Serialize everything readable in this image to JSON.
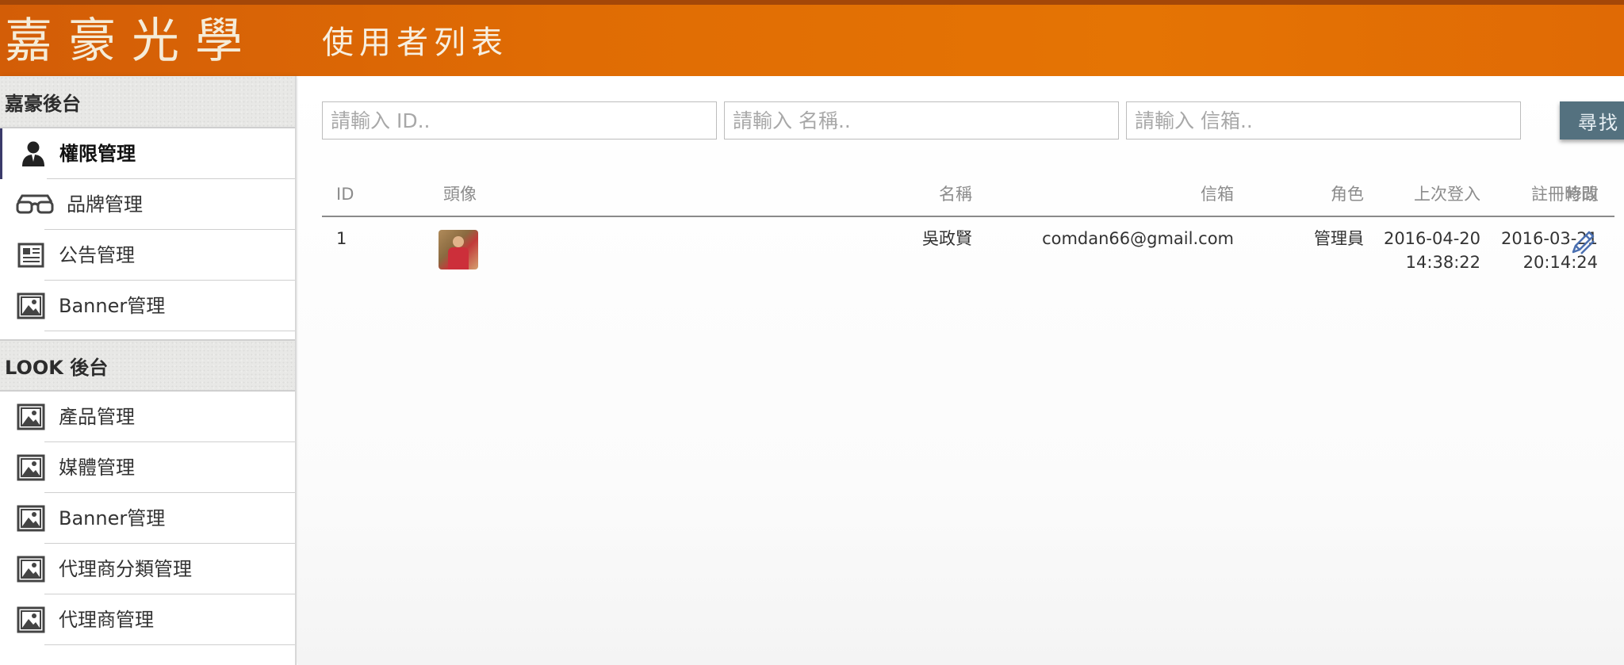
{
  "header": {
    "brand": "嘉豪光學",
    "page_title": "使用者列表"
  },
  "sidebar": {
    "sections": [
      {
        "title": "嘉豪後台",
        "items": [
          {
            "label": "權限管理",
            "icon": "user-icon"
          },
          {
            "label": "品牌管理",
            "icon": "glasses-icon"
          },
          {
            "label": "公告管理",
            "icon": "document-icon"
          },
          {
            "label": "Banner管理",
            "icon": "image-icon"
          }
        ]
      },
      {
        "title": "LOOK 後台",
        "items": [
          {
            "label": "產品管理",
            "icon": "image-icon"
          },
          {
            "label": "媒體管理",
            "icon": "image-icon"
          },
          {
            "label": "Banner管理",
            "icon": "image-icon"
          },
          {
            "label": "代理商分類管理",
            "icon": "image-icon"
          },
          {
            "label": "代理商管理",
            "icon": "image-icon"
          }
        ]
      }
    ]
  },
  "search": {
    "id_placeholder": "請輸入 ID..",
    "name_placeholder": "請輸入 名稱..",
    "email_placeholder": "請輸入 信箱..",
    "button_label": "尋找"
  },
  "table": {
    "headers": {
      "id": "ID",
      "avatar": "頭像",
      "name": "名稱",
      "email": "信箱",
      "role": "角色",
      "last_login": "上次登入",
      "registered": "註冊時間",
      "edit": "修改"
    },
    "rows": [
      {
        "id": "1",
        "name": "吳政賢",
        "email": "comdan66@gmail.com",
        "role": "管理員",
        "last_login_date": "2016-04-20",
        "last_login_time": "14:38:22",
        "registered_date": "2016-03-21",
        "registered_time": "20:14:24"
      }
    ]
  },
  "colors": {
    "header_orange": "#e57404",
    "search_button": "#54717f",
    "edit_icon": "#4a6fb0"
  }
}
